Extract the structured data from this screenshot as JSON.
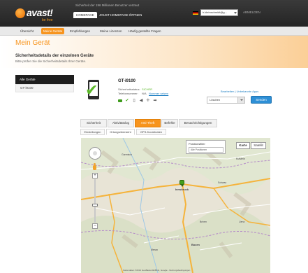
{
  "header": {
    "logo_text": "avast!",
    "logo_sub": "be free",
    "tagline": "Sicherheit der 196 Millionen Benutzer vertraut",
    "tabs": [
      "HOMEPAGE",
      "JOUST HOMEPAGE ÖFFNEN"
    ],
    "account_email": "h.kleinschmidt@g...",
    "logout": "ABMELDEN"
  },
  "nav": {
    "items": [
      "Übersicht",
      "Meine Geräte",
      "Empfehlungen",
      "Meine Lizenzen",
      "Häufig gestellte Fragen"
    ],
    "active_index": 1
  },
  "page": {
    "title": "Mein Gerät",
    "section_title": "Sicherheitsdetails der einzelnen Geräte",
    "section_subtitle": "Bitte prüfen Sie die Sicherheitsdetails Ihrer Geräte."
  },
  "sidebar": {
    "header": "Alle Geräte",
    "items": [
      "GT-i9100"
    ]
  },
  "device": {
    "name": "GT-i9100",
    "security_status_label": "Sicherheitsstatus:",
    "security_status_value": "SICHER",
    "phone_label": "Telefonnummer:",
    "phone_value": "N/A",
    "phone_link": "Nummer setzen",
    "right_links": "Bearbeiten | Unbekannte Apps",
    "select_value": "Löschen",
    "go_button": "Senden"
  },
  "status_icons": [
    "camera-icon",
    "check-icon",
    "lock-icon",
    "speaker-icon",
    "locate-icon",
    "arrow-icon"
  ],
  "tabs": {
    "items": [
      "Sicherheit",
      "Aktivitätslog",
      "Anti-Theft",
      "Befehle",
      "Benachrichtigungen"
    ],
    "active_index": 2
  },
  "subtabs": {
    "items": [
      "Einstellungen",
      "Ortungsübersicht",
      "GPS-Koordinaten"
    ],
    "active_index": 1
  },
  "map": {
    "position_label": "Positionsfilter",
    "position_select": "Alle Positionen",
    "type_buttons": [
      "Karte",
      "Satellit"
    ],
    "active_type_index": 0,
    "cities": [
      "Innsbruck",
      "Bozen",
      "Garmisch",
      "Schwaz",
      "Brixen",
      "Meran",
      "Lienz",
      "Kufstein"
    ],
    "copyright": "Kartendaten ©2013 GeoBasis-DE/BKG, Google - Nutzungsbedingungen",
    "colors": {
      "terrain": "#e8e4d6",
      "road_main": "#f5b33b",
      "road_minor": "#ffffff",
      "border": "#b48ac8",
      "marker": "#43a01c"
    }
  },
  "colors": {
    "accent": "#f7941d",
    "link": "#1e7fc3",
    "ok": "#5cb82a",
    "header": "#2e2e2e"
  }
}
